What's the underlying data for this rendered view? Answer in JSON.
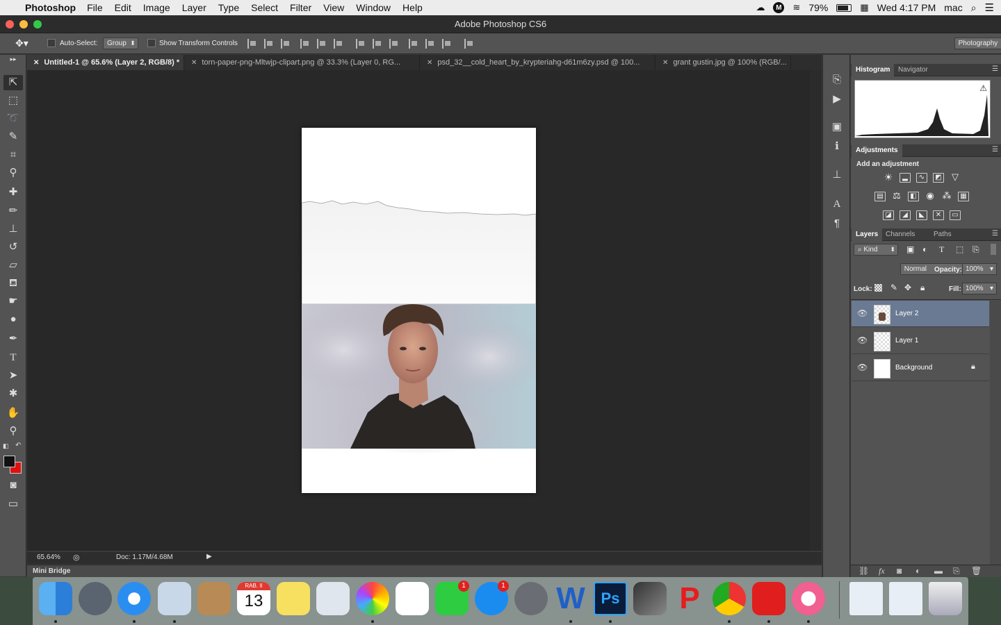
{
  "menubar": {
    "app_name": "Photoshop",
    "items": [
      "File",
      "Edit",
      "Image",
      "Layer",
      "Type",
      "Select",
      "Filter",
      "View",
      "Window",
      "Help"
    ],
    "battery": "79%",
    "clock": "Wed 4:17 PM",
    "user": "mac"
  },
  "window": {
    "title": "Adobe Photoshop CS6"
  },
  "options_bar": {
    "auto_select_label": "Auto-Select:",
    "auto_select_value": "Group",
    "transform_label": "Show Transform Controls",
    "workspace": "Photography"
  },
  "tabs": [
    {
      "label": "Untitled-1 @ 65.6% (Layer 2, RGB/8) *",
      "active": true
    },
    {
      "label": "torn-paper-png-Mltwjp-clipart.png @ 33.3% (Layer 0, RG...",
      "active": false
    },
    {
      "label": "psd_32__cold_heart_by_krypteriahg-d61m6zy.psd @ 100...",
      "active": false
    },
    {
      "label": "grant gustin.jpg @ 100% (RGB/...",
      "active": false
    }
  ],
  "status": {
    "zoom": "65.64%",
    "doc": "Doc: 1.17M/4.68M"
  },
  "mini_bridge": "Mini Bridge",
  "panels": {
    "histogram_tabs": [
      "Histogram",
      "Navigator"
    ],
    "adjustments_tab": "Adjustments",
    "adjustments_heading": "Add an adjustment",
    "layers_tabs": [
      "Layers",
      "Channels",
      "Paths"
    ],
    "filter_kind": "Kind",
    "blend_mode": "Normal",
    "opacity_label": "Opacity:",
    "opacity_value": "100%",
    "lock_label": "Lock:",
    "fill_label": "Fill:",
    "fill_value": "100%",
    "layers": [
      {
        "name": "Layer 2",
        "selected": true
      },
      {
        "name": "Layer 1",
        "selected": false
      },
      {
        "name": "Background",
        "selected": false
      }
    ]
  },
  "dock": {
    "calendar_month": "RAB. II",
    "calendar_day": "13",
    "badges": {
      "facetime": "1",
      "appstore": "1"
    }
  },
  "colors": {
    "foreground": "#111111",
    "background": "#e01010",
    "selected_layer": "#6b7a93"
  }
}
